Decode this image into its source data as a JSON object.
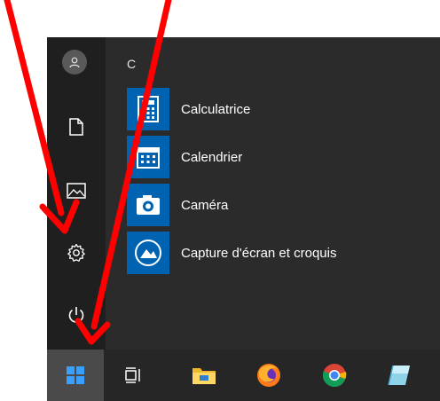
{
  "start_menu": {
    "section_letter": "C",
    "apps": [
      {
        "label": "Calculatrice",
        "icon": "calculator-icon"
      },
      {
        "label": "Calendrier",
        "icon": "calendar-icon"
      },
      {
        "label": "Caméra",
        "icon": "camera-icon"
      },
      {
        "label": "Capture d'écran et croquis",
        "icon": "snip-sketch-icon"
      }
    ],
    "rail": [
      "user-avatar-icon",
      "documents-icon",
      "pictures-icon",
      "settings-icon",
      "power-icon"
    ]
  },
  "taskbar": {
    "items": [
      "windows-start-icon",
      "task-view-icon",
      "file-explorer-icon",
      "firefox-icon",
      "chrome-icon",
      "notes-app-icon"
    ]
  },
  "colors": {
    "menu_bg": "#2b2b2b",
    "rail_bg": "#1f1f1f",
    "tile_blue": "#0063b1",
    "taskbar_bg": "#262626",
    "annotation_arrow": "#ff0000"
  }
}
